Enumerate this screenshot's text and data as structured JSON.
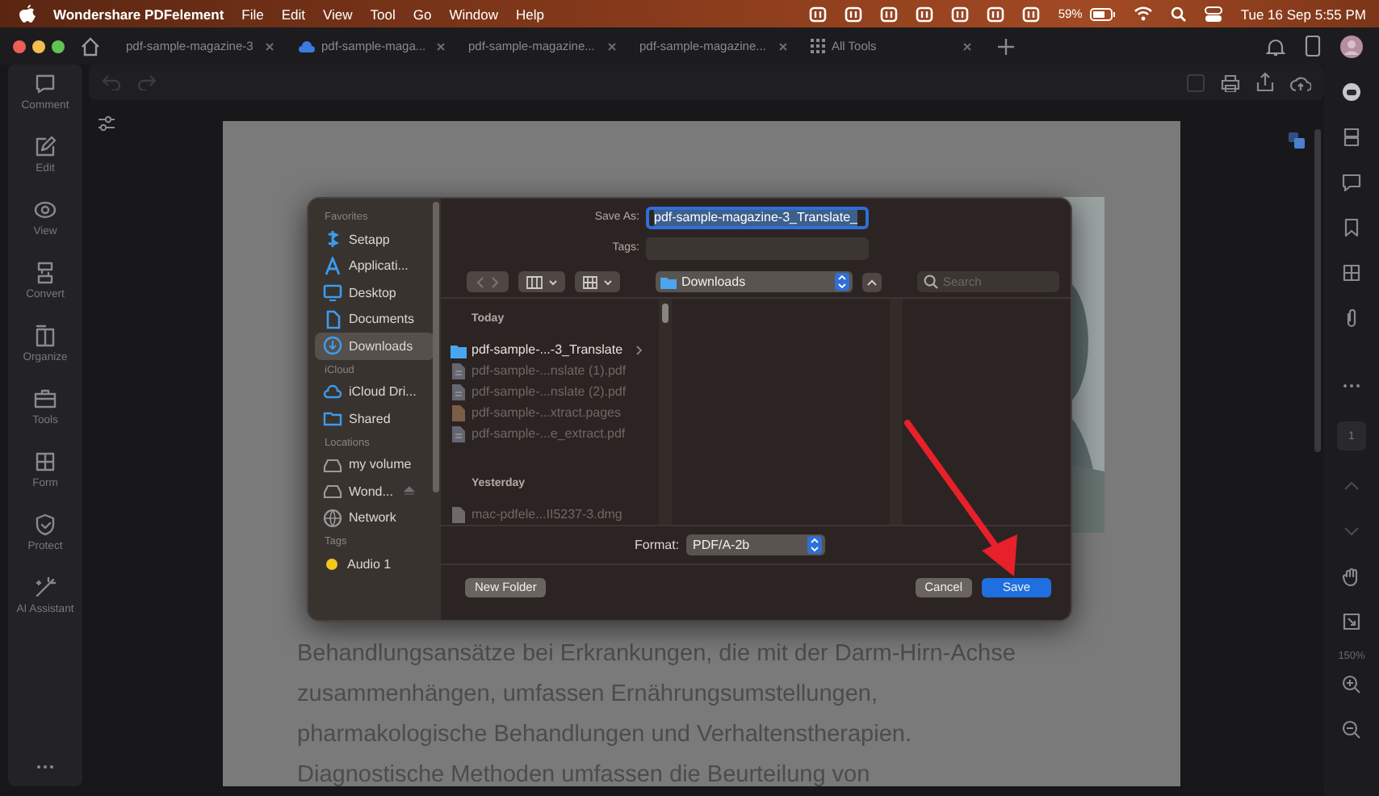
{
  "menubar": {
    "app_name": "Wondershare PDFelement",
    "menus": [
      "File",
      "Edit",
      "View",
      "Tool",
      "Go",
      "Window",
      "Help"
    ],
    "battery": "59%",
    "clock": "Tue 16 Sep  5:55 PM"
  },
  "tabs": [
    {
      "label": "pdf-sample-magazine-3",
      "kind": "doc"
    },
    {
      "label": "pdf-sample-maga...",
      "kind": "cloud"
    },
    {
      "label": "pdf-sample-magazine...",
      "kind": "doc"
    },
    {
      "label": "pdf-sample-magazine...",
      "kind": "doc"
    },
    {
      "label": "All Tools",
      "kind": "tools"
    }
  ],
  "left_toolbar": [
    {
      "label": "Comment",
      "kind": "comment"
    },
    {
      "label": "Edit",
      "kind": "edit"
    },
    {
      "label": "View",
      "kind": "view"
    },
    {
      "label": "Convert",
      "kind": "convert"
    },
    {
      "label": "Organize",
      "kind": "organize"
    },
    {
      "label": "Tools",
      "kind": "tools"
    },
    {
      "label": "Form",
      "kind": "form"
    },
    {
      "label": "Protect",
      "kind": "protect"
    },
    {
      "label": "AI Assistant",
      "kind": "ai"
    }
  ],
  "page_lines": [
    "Behandlungsansätze bei Erkrankungen, die mit der Darm-Hirn-Achse",
    "zusammenhängen, umfassen Ernährungsumstellungen,",
    "pharmakologische Behandlungen und Verhaltenstherapien.",
    "Diagnostische Methoden umfassen die Beurteilung von"
  ],
  "right_sidebar": {
    "page_number": "1",
    "zoom": "150%"
  },
  "dialog": {
    "save_as_label": "Save As:",
    "filename": "pdf-sample-magazine-3_Translate_",
    "tags_label": "Tags:",
    "location": "Downloads",
    "search_placeholder": "Search",
    "sidebar": [
      {
        "heading": "Favorites",
        "items": [
          {
            "label": "Setapp",
            "kind": "setapp",
            "selected": false
          },
          {
            "label": "Applicati...",
            "kind": "apps",
            "selected": false
          },
          {
            "label": "Desktop",
            "kind": "desktop",
            "selected": false
          },
          {
            "label": "Documents",
            "kind": "documents",
            "selected": false
          },
          {
            "label": "Downloads",
            "kind": "downloads",
            "selected": true
          }
        ]
      },
      {
        "heading": "iCloud",
        "items": [
          {
            "label": "iCloud Dri...",
            "kind": "cloud",
            "selected": false
          },
          {
            "label": "Shared",
            "kind": "shared",
            "selected": false
          }
        ]
      },
      {
        "heading": "Locations",
        "items": [
          {
            "label": "my volume",
            "kind": "drive",
            "selected": false
          },
          {
            "label": "Wond...",
            "kind": "drive-eject",
            "selected": false
          },
          {
            "label": "Network",
            "kind": "network",
            "selected": false
          }
        ]
      },
      {
        "heading": "Tags",
        "items": [
          {
            "label": "Audio 1",
            "kind": "tag",
            "color": "#f2c81d",
            "selected": false
          }
        ]
      }
    ],
    "browser": [
      {
        "heading": "Today",
        "items": [
          {
            "label": "pdf-sample-...-3_Translate",
            "kind": "folder",
            "disabled": false
          },
          {
            "label": "pdf-sample-...nslate (1).pdf",
            "kind": "pdf",
            "disabled": true
          },
          {
            "label": "pdf-sample-...nslate (2).pdf",
            "kind": "pdf",
            "disabled": true
          },
          {
            "label": "pdf-sample-...xtract.pages",
            "kind": "pages",
            "disabled": true
          },
          {
            "label": "pdf-sample-...e_extract.pdf",
            "kind": "pdf",
            "disabled": true
          }
        ]
      },
      {
        "heading": "Yesterday",
        "items": [
          {
            "label": "mac-pdfele...II5237-3.dmg",
            "kind": "dmg",
            "disabled": true
          }
        ]
      }
    ],
    "format_label": "Format:",
    "format": "PDF/A-2b",
    "new_folder": "New Folder",
    "cancel": "Cancel",
    "save": "Save"
  }
}
